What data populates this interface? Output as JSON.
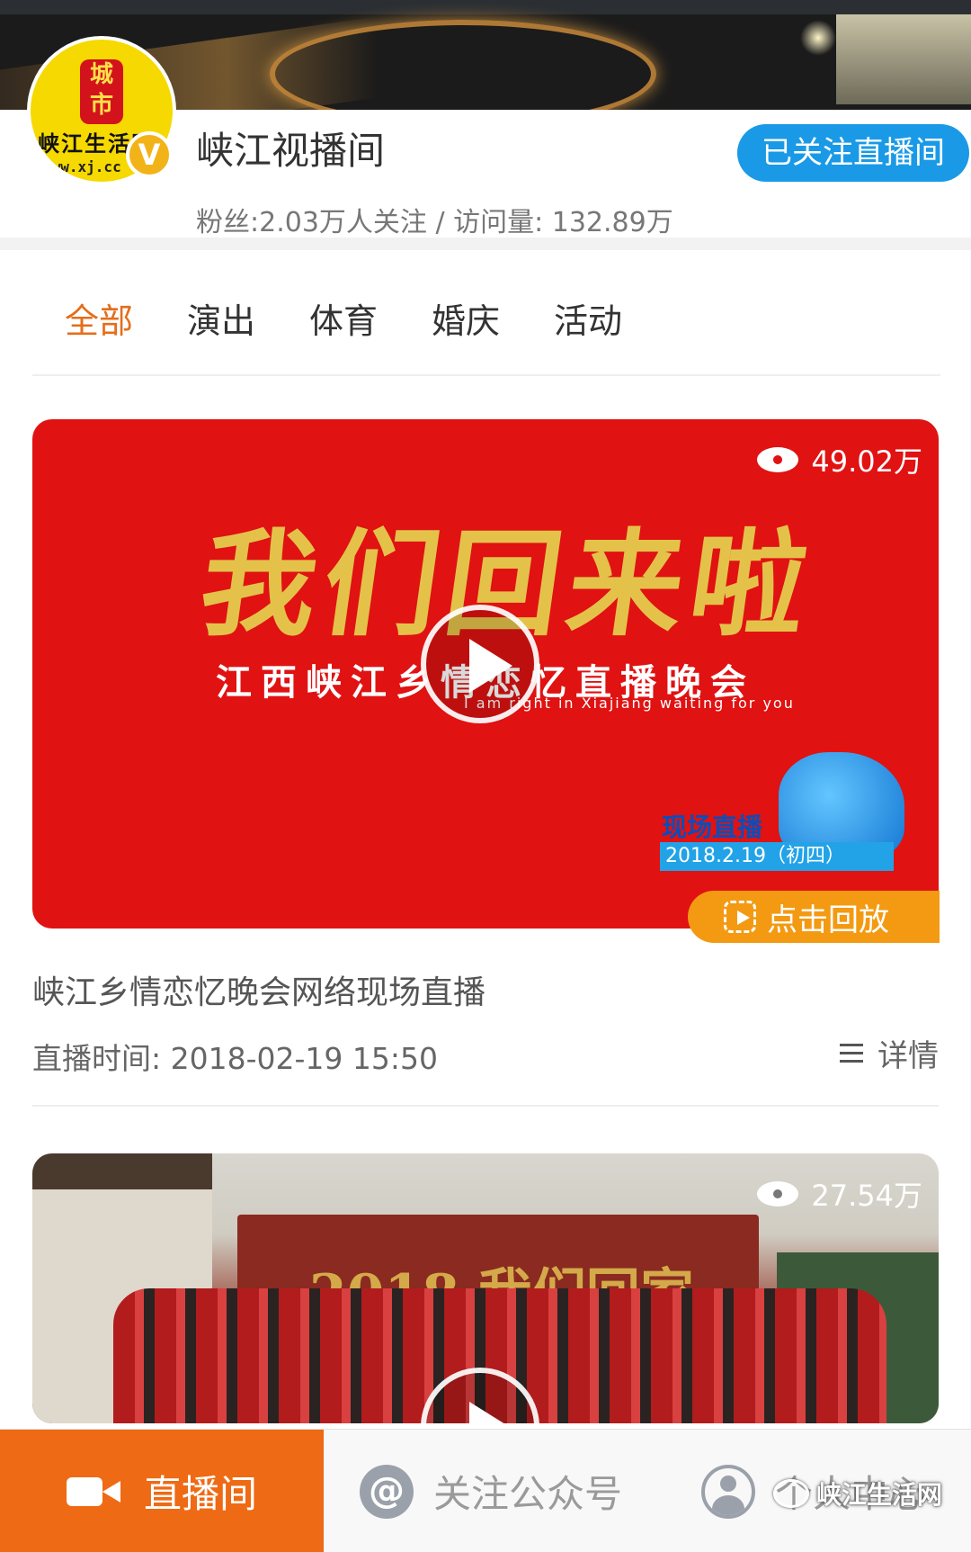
{
  "channel": {
    "avatar_text": "城市",
    "avatar_brush": "峡江生活网",
    "avatar_url": "www.xj.cc",
    "verified_badge": "V",
    "name": "峡江视播间",
    "follow_label": "已关注直播间",
    "stats": "粉丝:2.03万人关注 / 访问量: 132.89万"
  },
  "tabs": [
    {
      "label": "全部",
      "active": true
    },
    {
      "label": "演出",
      "active": false
    },
    {
      "label": "体育",
      "active": false
    },
    {
      "label": "婚庆",
      "active": false
    },
    {
      "label": "活动",
      "active": false
    }
  ],
  "cards": [
    {
      "views": "49.02万",
      "poster_calligraphy": "我们回来啦",
      "poster_subtitle": "江西峡江乡情恋忆直播晚会",
      "poster_subtitle_en": "I am right in Xiajiang waiting for you",
      "poster_live_tag": "现场直播",
      "poster_date": "2018.2.19（初四）",
      "replay_label": "点击回放",
      "title": "峡江乡情恋忆晚会网络现场直播",
      "time": "直播时间: 2018-02-19 15:50",
      "details_label": "详情"
    },
    {
      "views": "27.54万",
      "poster_stage_text": "2018 我们回家"
    }
  ],
  "bottom_nav": [
    {
      "label": "直播间",
      "icon": "video-camera-icon",
      "active": true
    },
    {
      "label": "关注公众号",
      "icon": "at-icon",
      "active": false
    },
    {
      "label": "个人中心",
      "icon": "person-icon",
      "active": false
    }
  ],
  "watermark": "峡江生活网",
  "colors": {
    "accent_orange": "#ef6a14",
    "active_tab": "#e46e1c",
    "follow_blue": "#1a9ae6",
    "poster_red": "#e01212",
    "replay_orange": "#f39a12"
  }
}
